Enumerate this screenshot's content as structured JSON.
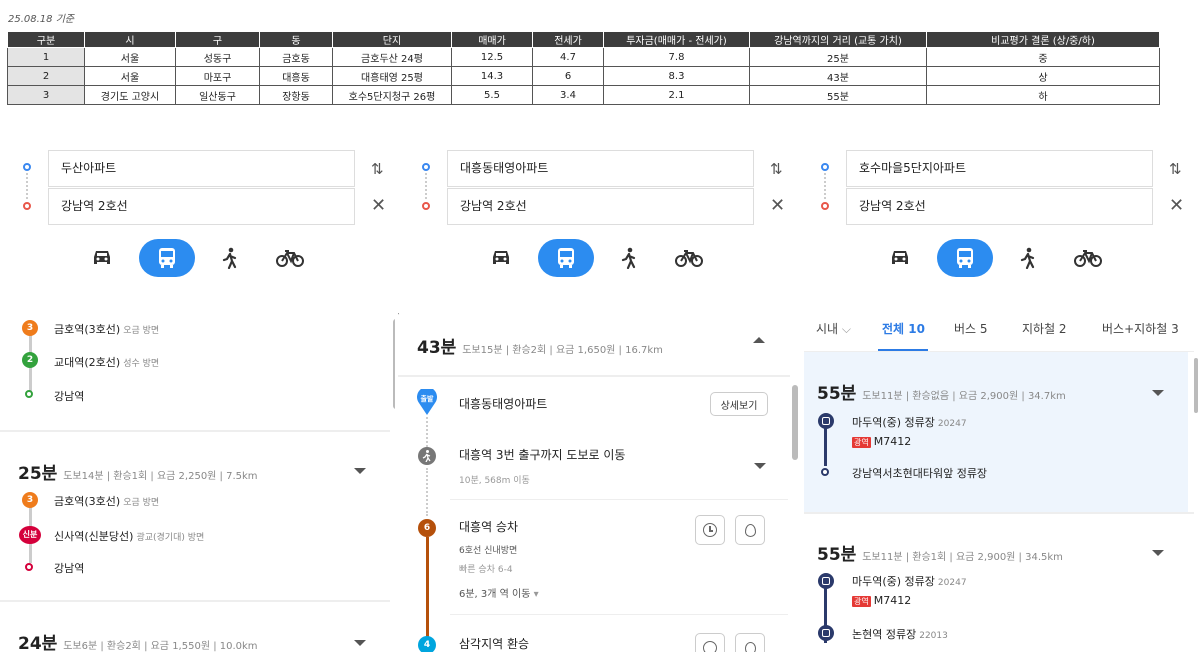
{
  "date_label": "25.08.18 기준",
  "table": {
    "headers": [
      "구분",
      "시",
      "구",
      "동",
      "단지",
      "매매가",
      "전세가",
      "투자금(매매가 - 전세가)",
      "강남역까지의 거리 (교통 가치)",
      "비교평가 결론 (상/중/하)"
    ],
    "rows": [
      [
        "1",
        "서울",
        "성동구",
        "금호동",
        "금호두산 24평",
        "12.5",
        "4.7",
        "7.8",
        "25분",
        "중"
      ],
      [
        "2",
        "서울",
        "마포구",
        "대흥동",
        "대흥태영 25평",
        "14.3",
        "6",
        "8.3",
        "43분",
        "상"
      ],
      [
        "3",
        "경기도 고양시",
        "일산동구",
        "장항동",
        "호수5단지청구 26평",
        "5.5",
        "3.4",
        "2.1",
        "55분",
        "하"
      ]
    ]
  },
  "panels": [
    {
      "origin": "두산아파트",
      "destination": "강남역 2호선"
    },
    {
      "origin": "대흥동태영아파트",
      "destination": "강남역 2호선"
    },
    {
      "origin": "호수마을5단지아파트",
      "destination": "강남역 2호선"
    }
  ],
  "colors": {
    "accent": "#2c8cf0",
    "line2": "#33a23d",
    "line3": "#ef7c1c",
    "shinbundang": "#d4003b",
    "line6": "#b5500b",
    "line4": "#00a5de",
    "bus_navy": "#2b3a6b",
    "bus_red_tag": "#e53935"
  },
  "left_list": {
    "top_stops": [
      {
        "badge": "3",
        "name": "금호역(3호선)",
        "dir": "오금 방면"
      },
      {
        "badge": "2",
        "name": "교대역(2호선)",
        "dir": "성수 방면"
      },
      {
        "name": "강남역"
      }
    ],
    "routes": [
      {
        "time": "25분",
        "meta": "도보14분 | 환승1회 | 요금 2,250원 | 7.5km",
        "stops": [
          {
            "badge": "3",
            "name": "금호역(3호선)",
            "dir": "오금 방면"
          },
          {
            "badge": "신분",
            "name": "신사역(신분당선)",
            "dir": "광교(경기대) 방면"
          },
          {
            "name": "강남역"
          }
        ]
      },
      {
        "time": "24분",
        "meta": "도보6분 | 환승2회 | 요금 1,550원 | 10.0km"
      }
    ]
  },
  "mid_list": {
    "time": "43분",
    "meta": "도보15분 | 환승2회 | 요금 1,650원 | 16.7km",
    "start_badge": "출발",
    "start_name": "대흥동태영아파트",
    "detail_button": "상세보기",
    "walk_title": "대흥역 3번 출구까지 도보로 이동",
    "walk_sub": "10분, 568m 이동",
    "board_badge": "6",
    "board_title": "대흥역 승차",
    "board_line": "6호선 신내방면",
    "board_fast": "빠른 승차 6-4",
    "board_move": "6분, 3개 역 이동",
    "transfer_badge": "4",
    "transfer_title": "삼각지역 환승"
  },
  "right_list": {
    "filter": "시내",
    "tabs": [
      {
        "label": "전체 10",
        "selected": true
      },
      {
        "label": "버스 5"
      },
      {
        "label": "지하철 2"
      },
      {
        "label": "버스+지하철 3"
      }
    ],
    "routes": [
      {
        "time": "55분",
        "meta": "도보11분 | 환승없음 | 요금 2,900원 | 34.7km",
        "stop1": "마두역(중) 정류장",
        "stop1_id": "20247",
        "tag": "광역",
        "bus": "M7412",
        "stop2": "강남역서초현대타워앞 정류장"
      },
      {
        "time": "55분",
        "meta": "도보11분 | 환승1회 | 요금 2,900원 | 34.5km",
        "stop1": "마두역(중) 정류장",
        "stop1_id": "20247",
        "tag": "광역",
        "bus": "M7412",
        "stop2": "논현역 정류장",
        "stop2_id": "22013"
      }
    ]
  }
}
